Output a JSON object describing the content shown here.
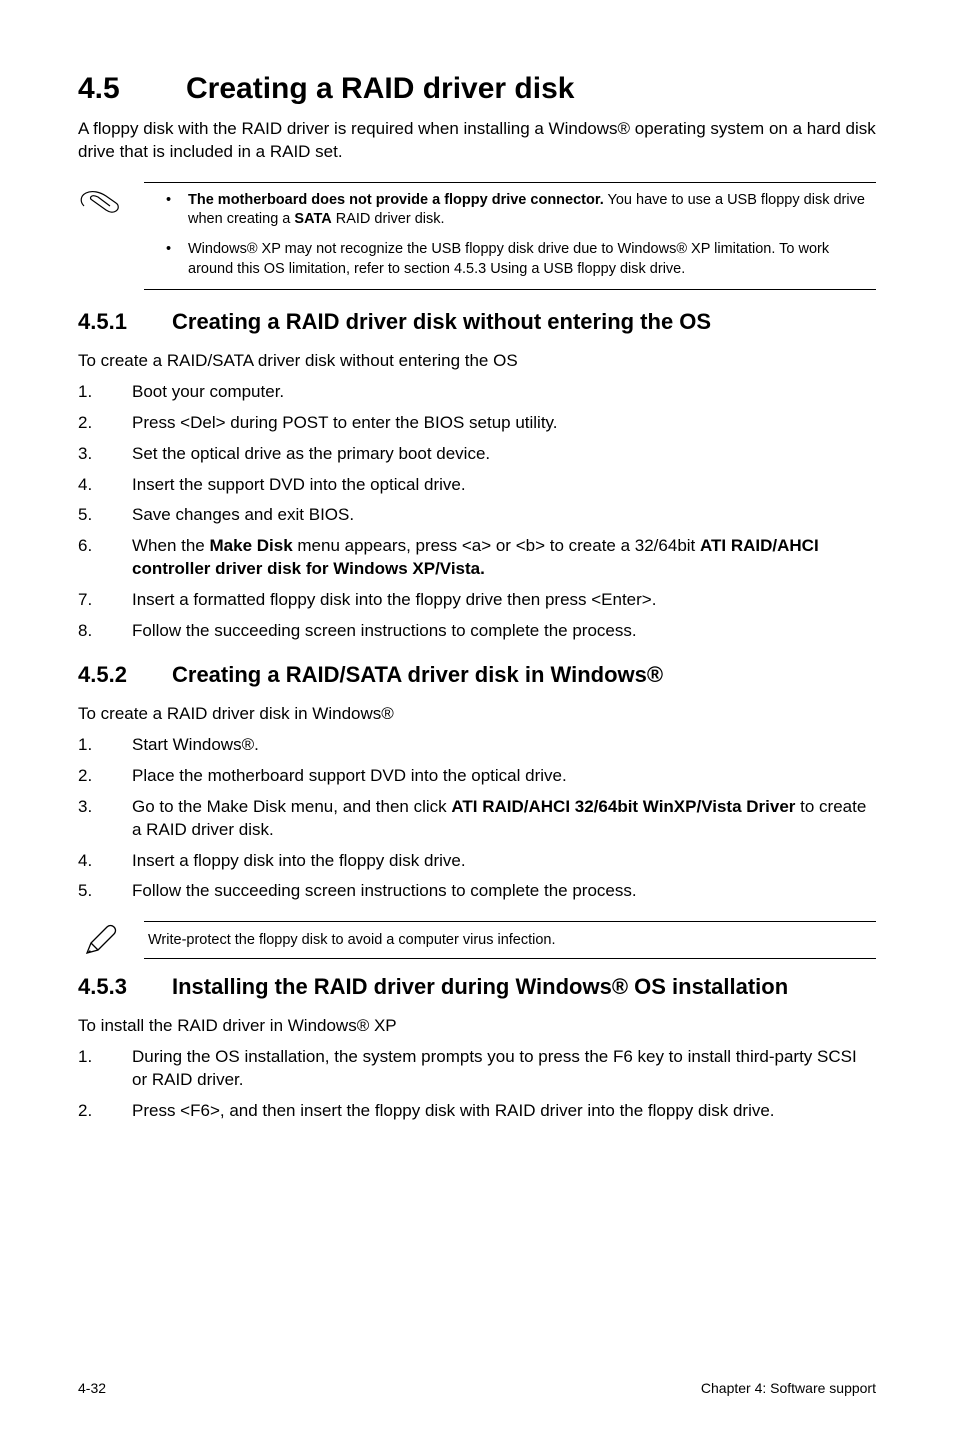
{
  "h1": {
    "num": "4.5",
    "title": "Creating a RAID driver disk"
  },
  "intro": "A floppy disk with the RAID driver is required when installing a Windows® operating system on a hard disk drive that is included in a RAID set.",
  "note1": {
    "b1_lead": "The motherboard does not provide a floppy drive connector.",
    "b1_tail": " You have to use a USB floppy disk drive when creating a ",
    "b1_bold2": "SATA",
    "b1_tail2": " RAID driver disk.",
    "b2": "Windows® XP may not recognize the USB floppy disk drive due to Windows® XP limitation. To work around this OS limitation, refer to section 4.5.3 Using a USB floppy disk drive."
  },
  "s451": {
    "num": "4.5.1",
    "title": "Creating a RAID driver disk without entering the OS",
    "lead": "To create a RAID/SATA driver disk without entering the OS",
    "steps": [
      "Boot your computer.",
      "Press <Del> during POST to enter the BIOS setup utility.",
      "Set the optical drive as the primary boot device.",
      "Insert the support DVD into the optical drive.",
      "Save changes and exit BIOS."
    ],
    "step6_a": "When the ",
    "step6_bold": "Make Disk",
    "step6_b": " menu appears, press <a> or <b> to create a 32/64bit ",
    "step6_bold2": "ATI RAID/AHCI controller driver disk for Windows XP/Vista.",
    "step7": "Insert a formatted floppy disk into the floppy drive then press <Enter>.",
    "step8": "Follow the succeeding screen instructions to complete the process."
  },
  "s452": {
    "num": "4.5.2",
    "title": "Creating a RAID/SATA driver disk in Windows®",
    "lead": "To create a RAID driver disk in Windows®",
    "step1": "Start Windows®.",
    "step2": "Place the motherboard support DVD into the optical drive.",
    "step3_a": "Go to the Make Disk menu, and then click ",
    "step3_bold": "ATI RAID/AHCI 32/64bit WinXP/Vista Driver",
    "step3_b": " to create a RAID driver disk.",
    "step4": "Insert a floppy disk into the floppy disk drive.",
    "step5": "Follow the succeeding screen instructions to complete the process."
  },
  "pencil_note": "Write-protect the floppy disk to avoid a computer virus infection.",
  "s453": {
    "num": "4.5.3",
    "title": "Installing the RAID driver during Windows® OS installation",
    "lead": "To install the RAID driver in Windows® XP",
    "step1": "During the OS installation, the system prompts you to press the F6 key to install third-party SCSI or RAID driver.",
    "step2": "Press <F6>, and then insert the floppy disk with RAID driver into the floppy disk drive."
  },
  "footer": {
    "left": "4-32",
    "right": "Chapter 4: Software support"
  }
}
